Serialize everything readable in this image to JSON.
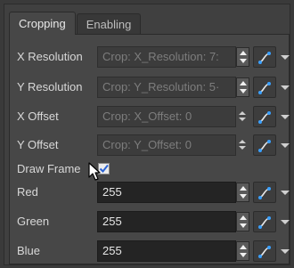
{
  "tabs": [
    {
      "label": "Cropping",
      "active": true
    },
    {
      "label": "Enabling",
      "active": false
    }
  ],
  "rows": [
    {
      "label": "X Resolution",
      "value": "Crop: X_Resolution: 7:",
      "enabled": false
    },
    {
      "label": "Y Resolution",
      "value": "Crop: Y_Resolution: 5·",
      "enabled": false
    },
    {
      "label": "X Offset",
      "value": "Crop: X_Offset: 0",
      "enabled": false
    },
    {
      "label": "Y Offset",
      "value": "Crop: Y_Offset: 0",
      "enabled": false
    },
    {
      "label": "Draw Frame",
      "checked": true
    },
    {
      "label": "Red",
      "value": "255",
      "enabled": true
    },
    {
      "label": "Green",
      "value": "255",
      "enabled": true
    },
    {
      "label": "Blue",
      "value": "255",
      "enabled": true
    }
  ],
  "icons": {
    "function_button": "function-curve-icon",
    "menu": "dropdown-arrow-icon",
    "spinner": "spinner-arrows-icon",
    "cursor": "mouse-pointer-icon"
  },
  "colors": {
    "panel": "#474747",
    "active_field": "#242424",
    "accent_link": "#3aa0ff"
  }
}
